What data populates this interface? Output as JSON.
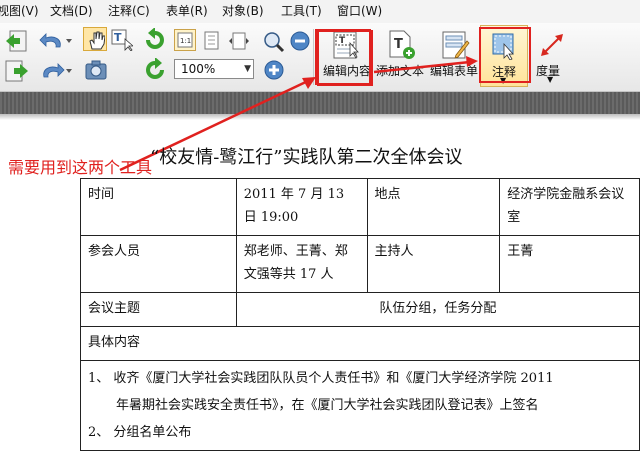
{
  "menu": {
    "items": [
      "视图(V)",
      "文档(D)",
      "注释(C)",
      "表单(R)",
      "对象(B)",
      "工具(T)",
      "窗口(W)"
    ]
  },
  "toolbar": {
    "zoom_value": "100%",
    "edit_content_label": "编辑内容",
    "add_text_label": "添加文本",
    "edit_form_label": "编辑表单",
    "annotate_label": "注释",
    "measure_label": "度量"
  },
  "annotation": {
    "text": "需要用到这两个工具",
    "color": "#e0211f"
  },
  "document": {
    "title": "“校友情-鹭江行”实践队第二次全体会议",
    "table": {
      "time_label": "时间",
      "time_value": "2011 年 7 月 13 日 19:00",
      "place_label": "地点",
      "place_value": "经济学院金融系会议室",
      "attendees_label": "参会人员",
      "attendees_value": "郑老师、王菁、郑文强等共 17 人",
      "host_label": "主持人",
      "host_value": "王菁",
      "topic_label": "会议主题",
      "topic_value": "队伍分组，任务分配",
      "content_label": "具体内容",
      "content_line1": "1、 收齐《厦门大学社会实践团队队员个人责任书》和《厦门大学经济学院 2011",
      "content_line2": "年暑期社会实践安全责任书》，在《厦门大学社会实践团队登记表》上签名",
      "content_line3": "2、 分组名单公布"
    }
  }
}
